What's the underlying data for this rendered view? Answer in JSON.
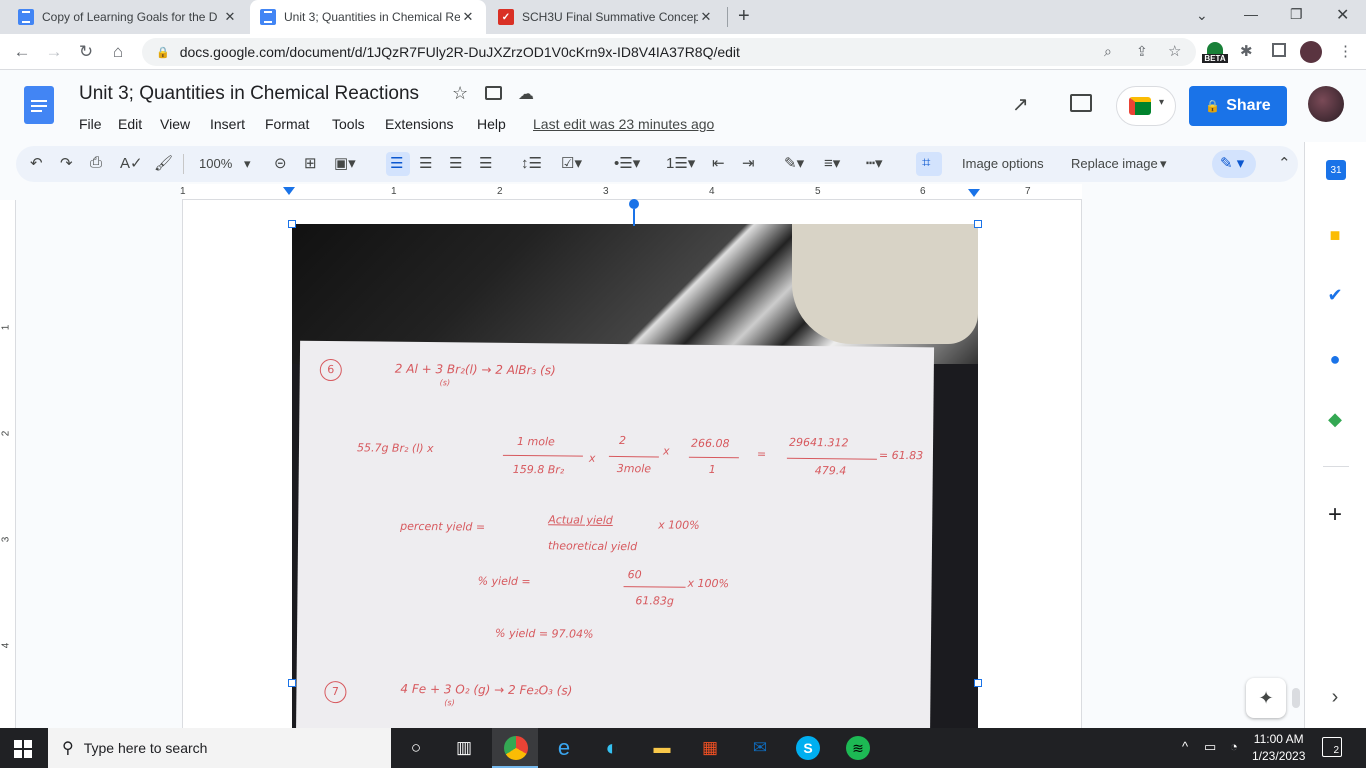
{
  "tabs": [
    {
      "title": "Copy of Learning Goals for the D",
      "active": false
    },
    {
      "title": "Unit 3; Quantities in Chemical Re",
      "active": true
    },
    {
      "title": "SCH3U Final Summative Concept",
      "active": false
    }
  ],
  "address": {
    "url": "docs.google.com/document/d/1JQzR7FUly2R-DuJXZrzOD1V0cKrn9x-ID8V4IA37R8Q/edit",
    "beta_badge": "BETA"
  },
  "doc": {
    "title": "Unit 3; Quantities in Chemical Reactions",
    "menus": [
      "File",
      "Edit",
      "View",
      "Insert",
      "Format",
      "Tools",
      "Extensions",
      "Help"
    ],
    "last_edit": "Last edit was 23 minutes ago",
    "share_label": "Share"
  },
  "toolbar": {
    "zoom": "100%",
    "image_options": "Image options",
    "replace_image": "Replace image"
  },
  "ruler": {
    "marks": [
      "1",
      "1",
      "2",
      "3",
      "4",
      "5",
      "6",
      "7"
    ],
    "vmarks": [
      "1",
      "2",
      "3",
      "4"
    ]
  },
  "handwriting": {
    "q6": "6",
    "eq1": "2  Al  +  3  Br₂(l)  →  2  AlBr₃ (s)",
    "eq1_sub": "(s)",
    "calc_a": "55.7g Br₂ (l) x",
    "calc_b_top": "1 mole",
    "calc_b_bot": "159.8 Br₂",
    "calc_c_top": "2",
    "calc_c_bot": "3mole",
    "calc_d_top": "266.08",
    "calc_d_bot": "1",
    "calc_e_top": "29641.312",
    "calc_e_bot": "479.4",
    "calc_result": "= 61.83",
    "py_label": "percent yield  =",
    "py_top": "Actual yield",
    "py_bot": "theoretical yield",
    "py_x": "x 100%",
    "py2_label": "% yield  =",
    "py2_top": "60",
    "py2_bot": "61.83g",
    "py2_x": "x 100%",
    "py3": "% yield  =  97.04%",
    "q7": "7",
    "eq2": "4  Fe  +  3  O₂ (g)  →  2 Fe₂O₃ (s)",
    "eq2_sub": "(s)"
  },
  "taskbar": {
    "search_placeholder": "Type here to search",
    "time": "11:00 AM",
    "date": "1/23/2023",
    "notif_count": "2"
  },
  "colors": {
    "accent": "#1a73e8",
    "ink": "#d7595e"
  }
}
